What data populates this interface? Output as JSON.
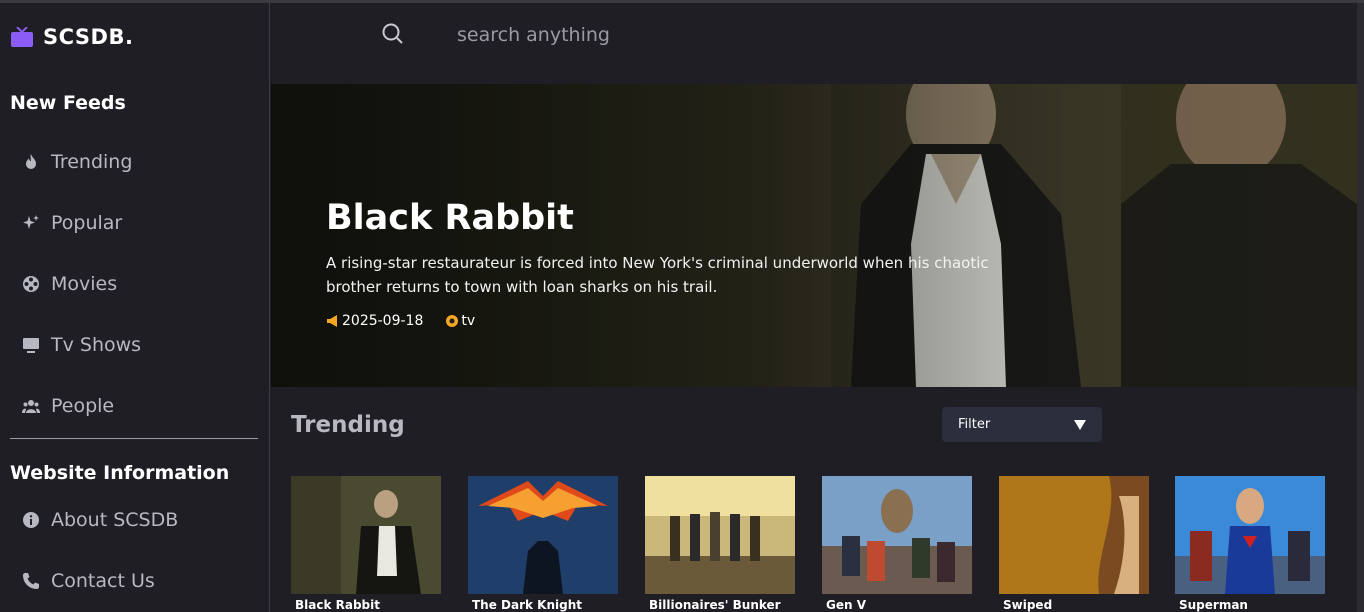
{
  "app": {
    "name": "SCSDB."
  },
  "sidebar": {
    "section_feeds": "New Feeds",
    "feeds": [
      {
        "label": "Trending",
        "icon": "flame-icon"
      },
      {
        "label": "Popular",
        "icon": "sparkle-icon"
      },
      {
        "label": "Movies",
        "icon": "film-reel-icon"
      },
      {
        "label": "Tv Shows",
        "icon": "tv-icon"
      },
      {
        "label": "People",
        "icon": "people-icon"
      }
    ],
    "section_info": "Website Information",
    "info": [
      {
        "label": "About SCSDB",
        "icon": "info-icon"
      },
      {
        "label": "Contact Us",
        "icon": "phone-icon"
      }
    ]
  },
  "search": {
    "placeholder": "search anything"
  },
  "hero": {
    "title": "Black Rabbit",
    "description": "A rising-star restaurateur is forced into New York's criminal underworld when his chaotic brother returns to town with loan sharks on his trail.",
    "date": "2025-09-18",
    "media_type": "tv"
  },
  "trending": {
    "title": "Trending",
    "filter_label": "Filter",
    "cards": [
      {
        "title": "Black Rabbit"
      },
      {
        "title": "The Dark Knight"
      },
      {
        "title": "Billionaires' Bunker"
      },
      {
        "title": "Gen V"
      },
      {
        "title": "Swiped"
      },
      {
        "title": "Superman"
      }
    ]
  },
  "colors": {
    "accent": "#8b5cf6",
    "meta_icon": "#f5a623",
    "background": "#1f1e25"
  }
}
